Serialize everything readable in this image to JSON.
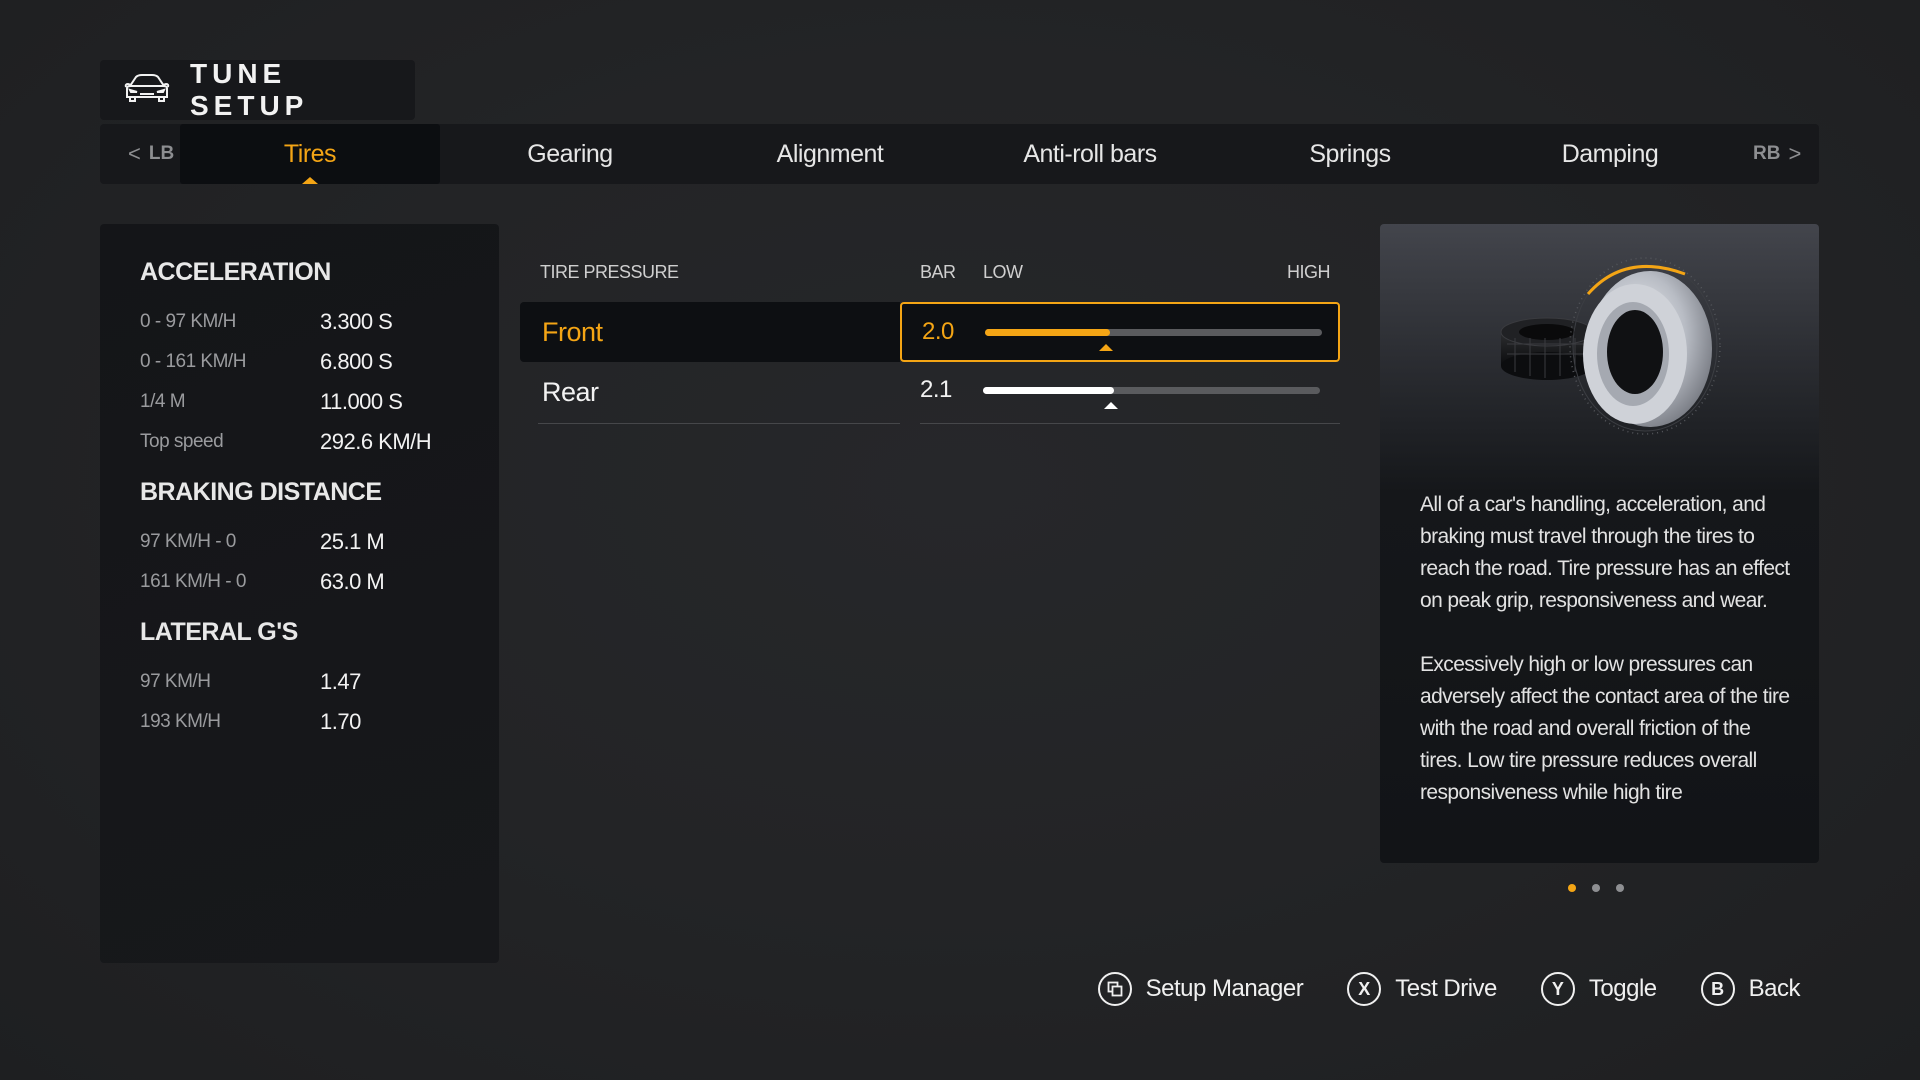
{
  "header": {
    "title": "TUNE SETUP",
    "icon": "car-front-icon"
  },
  "tabs": {
    "left_bumper": {
      "label": "LB",
      "arrow": "<"
    },
    "right_bumper": {
      "label": "RB",
      "arrow": ">"
    },
    "items": [
      {
        "label": "Tires",
        "active": true
      },
      {
        "label": "Gearing",
        "active": false
      },
      {
        "label": "Alignment",
        "active": false
      },
      {
        "label": "Anti-roll bars",
        "active": false
      },
      {
        "label": "Springs",
        "active": false
      },
      {
        "label": "Damping",
        "active": false
      }
    ]
  },
  "stats": {
    "sections": [
      {
        "title": "ACCELERATION",
        "rows": [
          {
            "label": "0 - 97 KM/H",
            "value": "3.300 S"
          },
          {
            "label": "0 - 161 KM/H",
            "value": "6.800 S"
          },
          {
            "label": "1/4 M",
            "value": "11.000 S"
          },
          {
            "label": "Top speed",
            "value": "292.6 KM/H"
          }
        ]
      },
      {
        "title": "BRAKING DISTANCE",
        "rows": [
          {
            "label": "97 KM/H - 0",
            "value": "25.1 M"
          },
          {
            "label": "161 KM/H - 0",
            "value": "63.0 M"
          }
        ]
      },
      {
        "title": "LATERAL G'S",
        "rows": [
          {
            "label": "97 KM/H",
            "value": "1.47"
          },
          {
            "label": "193 KM/H",
            "value": "1.70"
          }
        ]
      }
    ]
  },
  "tuning": {
    "section_title": "TIRE PRESSURE",
    "unit_label": "BAR",
    "low_label": "LOW",
    "high_label": "HIGH",
    "rows": [
      {
        "label": "Front",
        "value": "2.0",
        "slider_fraction": 0.37,
        "selected": true
      },
      {
        "label": "Rear",
        "value": "2.1",
        "slider_fraction": 0.39,
        "selected": false
      }
    ]
  },
  "info": {
    "image": "tire-illustration",
    "paragraphs": [
      "All of a car's handling, acceleration, and braking must travel through the tires to reach the road. Tire pressure has an effect on peak grip, responsiveness and wear.",
      "Excessively high or low pressures can adversely affect the contact area of the tire with the road and overall friction of the tires. Low tire pressure reduces overall responsiveness while high tire"
    ],
    "pages": {
      "count": 3,
      "current": 1
    }
  },
  "actions": [
    {
      "glyph": "view-icon",
      "label": "Setup Manager"
    },
    {
      "glyph": "X",
      "label": "Test Drive"
    },
    {
      "glyph": "Y",
      "label": "Toggle"
    },
    {
      "glyph": "B",
      "label": "Back"
    }
  ],
  "colors": {
    "accent": "#f4a515",
    "background": "#232426",
    "panel": "#16171a"
  }
}
